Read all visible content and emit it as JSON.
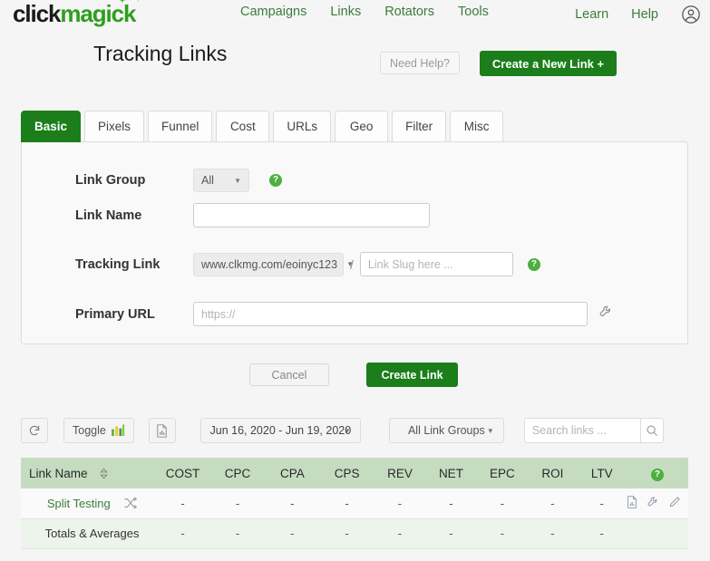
{
  "brand": {
    "part1": "click",
    "part2": "magick",
    "accent": "#2e9e1f"
  },
  "nav": {
    "main": [
      "Campaigns",
      "Links",
      "Rotators",
      "Tools"
    ],
    "right": [
      "Learn",
      "Help"
    ],
    "account_icon": "account-circle-icon"
  },
  "header": {
    "title": "Tracking Links",
    "need_help_label": "Need Help?",
    "create_new_link_label": "Create a New Link  +"
  },
  "tabs": [
    {
      "label": "Basic",
      "active": true
    },
    {
      "label": "Pixels",
      "active": false
    },
    {
      "label": "Funnel",
      "active": false
    },
    {
      "label": "Cost",
      "active": false
    },
    {
      "label": "URLs",
      "active": false
    },
    {
      "label": "Geo",
      "active": false
    },
    {
      "label": "Filter",
      "active": false
    },
    {
      "label": "Misc",
      "active": false
    }
  ],
  "form": {
    "link_group": {
      "label": "Link Group",
      "value": "All",
      "help": "?"
    },
    "link_name": {
      "label": "Link Name",
      "value": "",
      "placeholder": ""
    },
    "tracking_link": {
      "label": "Tracking Link",
      "domain": "www.clkmg.com/eoinyc123",
      "separator": "/",
      "slug_placeholder": "Link Slug here ...",
      "slug_value": "",
      "help": "?"
    },
    "primary_url": {
      "label": "Primary URL",
      "placeholder": "https://",
      "value": "",
      "tool_icon": "wrench-icon"
    }
  },
  "actions": {
    "cancel_label": "Cancel",
    "create_label": "Create Link"
  },
  "toolbar": {
    "refresh_icon": "refresh-icon",
    "toggle_label": "Toggle",
    "toggle_icon": "bar-chart-icon",
    "report_icon": "report-document-icon",
    "date_range": "Jun 16, 2020 - Jun 19, 2020",
    "link_groups_filter": "All Link Groups",
    "search_placeholder": "Search links ...",
    "search_value": "",
    "search_icon": "search-icon"
  },
  "table": {
    "header_bg": "#c6dcc0",
    "columns": [
      "Link Name",
      "COST",
      "CPC",
      "CPA",
      "CPS",
      "REV",
      "NET",
      "EPC",
      "ROI",
      "LTV"
    ],
    "header_help": "?",
    "rows": [
      {
        "name": "Split Testing",
        "name_icon": "shuffle-icon",
        "type": "link",
        "values": [
          "-",
          "-",
          "-",
          "-",
          "-",
          "-",
          "-",
          "-",
          "-"
        ],
        "actions": [
          "report-document-icon",
          "wrench-icon",
          "pencil-icon"
        ]
      },
      {
        "name": "Totals & Averages",
        "type": "totals",
        "values": [
          "-",
          "-",
          "-",
          "-",
          "-",
          "-",
          "-",
          "-",
          "-"
        ],
        "actions": []
      }
    ]
  }
}
